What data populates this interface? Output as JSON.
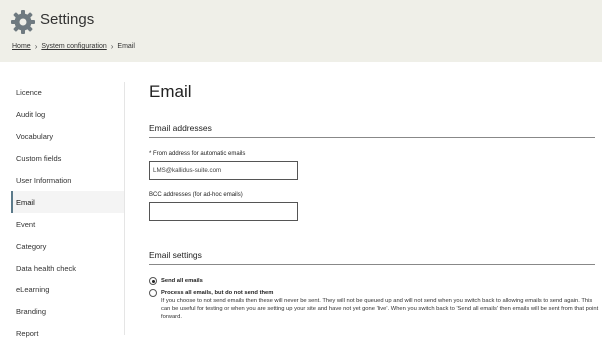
{
  "header": {
    "title": "Settings",
    "icon": "gear-icon"
  },
  "breadcrumb": {
    "items": [
      "Home",
      "System configuration",
      "Email"
    ],
    "separator": "›"
  },
  "sidebar": {
    "items": [
      {
        "label": "Licence"
      },
      {
        "label": "Audit log"
      },
      {
        "label": "Vocabulary"
      },
      {
        "label": "Custom fields"
      },
      {
        "label": "User Information"
      },
      {
        "label": "Email",
        "active": true
      },
      {
        "label": "Event"
      },
      {
        "label": "Category"
      },
      {
        "label": "Data health check"
      },
      {
        "label": "eLearning"
      },
      {
        "label": "Branding"
      },
      {
        "label": "Report"
      }
    ]
  },
  "main": {
    "page_title": "Email",
    "email_addresses": {
      "section_title": "Email addresses",
      "from_label": "* From address for automatic emails",
      "from_value": "LMS@kallidus-suite.com",
      "bcc_label": "BCC addresses (for ad-hoc emails)",
      "bcc_value": ""
    },
    "email_settings": {
      "section_title": "Email settings",
      "options": [
        {
          "label": "Send all emails",
          "checked": true,
          "description": ""
        },
        {
          "label": "Process all emails, but do not send them",
          "checked": false,
          "description": "If you choose to not send emails then these will never be sent. They will not be queued up and will not send when you switch back to allowing emails to send again. This can be useful for testing or when you are setting up your site and have not yet gone 'live'. When you switch back to 'Send all emails' then emails will be sent from that point forward."
        }
      ]
    }
  },
  "colors": {
    "header_bg": "#efefe8",
    "active_marker": "#5b7a8a"
  }
}
